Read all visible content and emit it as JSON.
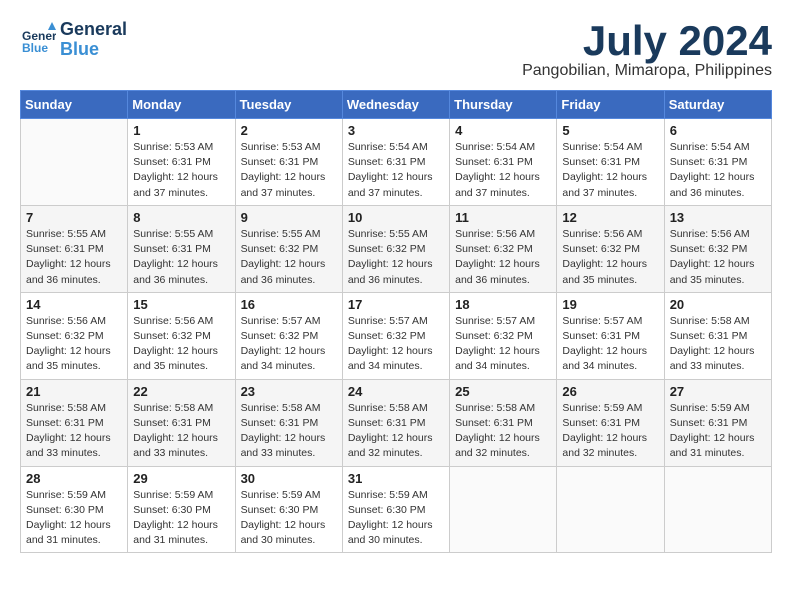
{
  "header": {
    "logo_line1": "General",
    "logo_line2": "Blue",
    "month": "July 2024",
    "location": "Pangobilian, Mimaropa, Philippines"
  },
  "weekdays": [
    "Sunday",
    "Monday",
    "Tuesday",
    "Wednesday",
    "Thursday",
    "Friday",
    "Saturday"
  ],
  "weeks": [
    [
      {
        "day": "",
        "info": ""
      },
      {
        "day": "1",
        "info": "Sunrise: 5:53 AM\nSunset: 6:31 PM\nDaylight: 12 hours\nand 37 minutes."
      },
      {
        "day": "2",
        "info": "Sunrise: 5:53 AM\nSunset: 6:31 PM\nDaylight: 12 hours\nand 37 minutes."
      },
      {
        "day": "3",
        "info": "Sunrise: 5:54 AM\nSunset: 6:31 PM\nDaylight: 12 hours\nand 37 minutes."
      },
      {
        "day": "4",
        "info": "Sunrise: 5:54 AM\nSunset: 6:31 PM\nDaylight: 12 hours\nand 37 minutes."
      },
      {
        "day": "5",
        "info": "Sunrise: 5:54 AM\nSunset: 6:31 PM\nDaylight: 12 hours\nand 37 minutes."
      },
      {
        "day": "6",
        "info": "Sunrise: 5:54 AM\nSunset: 6:31 PM\nDaylight: 12 hours\nand 36 minutes."
      }
    ],
    [
      {
        "day": "7",
        "info": "Sunrise: 5:55 AM\nSunset: 6:31 PM\nDaylight: 12 hours\nand 36 minutes."
      },
      {
        "day": "8",
        "info": "Sunrise: 5:55 AM\nSunset: 6:31 PM\nDaylight: 12 hours\nand 36 minutes."
      },
      {
        "day": "9",
        "info": "Sunrise: 5:55 AM\nSunset: 6:32 PM\nDaylight: 12 hours\nand 36 minutes."
      },
      {
        "day": "10",
        "info": "Sunrise: 5:55 AM\nSunset: 6:32 PM\nDaylight: 12 hours\nand 36 minutes."
      },
      {
        "day": "11",
        "info": "Sunrise: 5:56 AM\nSunset: 6:32 PM\nDaylight: 12 hours\nand 36 minutes."
      },
      {
        "day": "12",
        "info": "Sunrise: 5:56 AM\nSunset: 6:32 PM\nDaylight: 12 hours\nand 35 minutes."
      },
      {
        "day": "13",
        "info": "Sunrise: 5:56 AM\nSunset: 6:32 PM\nDaylight: 12 hours\nand 35 minutes."
      }
    ],
    [
      {
        "day": "14",
        "info": "Sunrise: 5:56 AM\nSunset: 6:32 PM\nDaylight: 12 hours\nand 35 minutes."
      },
      {
        "day": "15",
        "info": "Sunrise: 5:56 AM\nSunset: 6:32 PM\nDaylight: 12 hours\nand 35 minutes."
      },
      {
        "day": "16",
        "info": "Sunrise: 5:57 AM\nSunset: 6:32 PM\nDaylight: 12 hours\nand 34 minutes."
      },
      {
        "day": "17",
        "info": "Sunrise: 5:57 AM\nSunset: 6:32 PM\nDaylight: 12 hours\nand 34 minutes."
      },
      {
        "day": "18",
        "info": "Sunrise: 5:57 AM\nSunset: 6:32 PM\nDaylight: 12 hours\nand 34 minutes."
      },
      {
        "day": "19",
        "info": "Sunrise: 5:57 AM\nSunset: 6:31 PM\nDaylight: 12 hours\nand 34 minutes."
      },
      {
        "day": "20",
        "info": "Sunrise: 5:58 AM\nSunset: 6:31 PM\nDaylight: 12 hours\nand 33 minutes."
      }
    ],
    [
      {
        "day": "21",
        "info": "Sunrise: 5:58 AM\nSunset: 6:31 PM\nDaylight: 12 hours\nand 33 minutes."
      },
      {
        "day": "22",
        "info": "Sunrise: 5:58 AM\nSunset: 6:31 PM\nDaylight: 12 hours\nand 33 minutes."
      },
      {
        "day": "23",
        "info": "Sunrise: 5:58 AM\nSunset: 6:31 PM\nDaylight: 12 hours\nand 33 minutes."
      },
      {
        "day": "24",
        "info": "Sunrise: 5:58 AM\nSunset: 6:31 PM\nDaylight: 12 hours\nand 32 minutes."
      },
      {
        "day": "25",
        "info": "Sunrise: 5:58 AM\nSunset: 6:31 PM\nDaylight: 12 hours\nand 32 minutes."
      },
      {
        "day": "26",
        "info": "Sunrise: 5:59 AM\nSunset: 6:31 PM\nDaylight: 12 hours\nand 32 minutes."
      },
      {
        "day": "27",
        "info": "Sunrise: 5:59 AM\nSunset: 6:31 PM\nDaylight: 12 hours\nand 31 minutes."
      }
    ],
    [
      {
        "day": "28",
        "info": "Sunrise: 5:59 AM\nSunset: 6:30 PM\nDaylight: 12 hours\nand 31 minutes."
      },
      {
        "day": "29",
        "info": "Sunrise: 5:59 AM\nSunset: 6:30 PM\nDaylight: 12 hours\nand 31 minutes."
      },
      {
        "day": "30",
        "info": "Sunrise: 5:59 AM\nSunset: 6:30 PM\nDaylight: 12 hours\nand 30 minutes."
      },
      {
        "day": "31",
        "info": "Sunrise: 5:59 AM\nSunset: 6:30 PM\nDaylight: 12 hours\nand 30 minutes."
      },
      {
        "day": "",
        "info": ""
      },
      {
        "day": "",
        "info": ""
      },
      {
        "day": "",
        "info": ""
      }
    ]
  ]
}
